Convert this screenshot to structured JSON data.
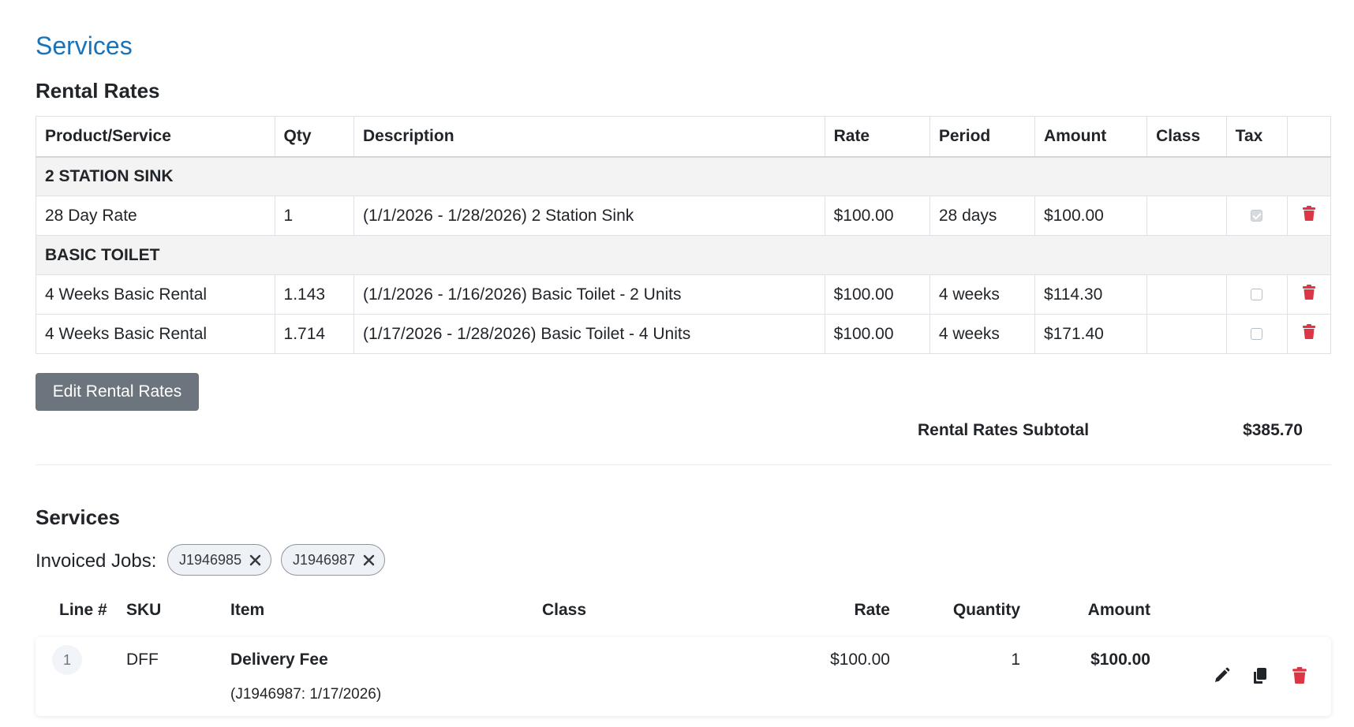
{
  "header": {
    "title": "Services"
  },
  "rental_rates": {
    "title": "Rental Rates",
    "columns": [
      "Product/Service",
      "Qty",
      "Description",
      "Rate",
      "Period",
      "Amount",
      "Class",
      "Tax"
    ],
    "groups": [
      {
        "name": "2 STATION SINK",
        "rows": [
          {
            "product": "28 Day Rate",
            "qty": "1",
            "description": "(1/1/2026 - 1/28/2026) 2 Station Sink",
            "rate": "$100.00",
            "period": "28 days",
            "amount": "$100.00",
            "class": "",
            "tax": true
          }
        ]
      },
      {
        "name": "BASIC TOILET",
        "rows": [
          {
            "product": "4 Weeks Basic Rental",
            "qty": "1.143",
            "description": "(1/1/2026 - 1/16/2026) Basic Toilet - 2 Units",
            "rate": "$100.00",
            "period": "4 weeks",
            "amount": "$114.30",
            "class": "",
            "tax": false
          },
          {
            "product": "4 Weeks Basic Rental",
            "qty": "1.714",
            "description": "(1/17/2026 - 1/28/2026) Basic Toilet - 4 Units",
            "rate": "$100.00",
            "period": "4 weeks",
            "amount": "$171.40",
            "class": "",
            "tax": false
          }
        ]
      }
    ],
    "edit_button": "Edit Rental Rates",
    "subtotal_label": "Rental Rates Subtotal",
    "subtotal_value": "$385.70"
  },
  "services": {
    "title": "Services",
    "invoiced_label": "Invoiced Jobs:",
    "jobs": [
      "J1946985",
      "J1946987"
    ],
    "columns": {
      "line": "Line #",
      "sku": "SKU",
      "item": "Item",
      "class": "Class",
      "rate": "Rate",
      "quantity": "Quantity",
      "amount": "Amount"
    },
    "lines": [
      {
        "line": "1",
        "sku": "DFF",
        "item": "Delivery Fee",
        "detail": "(J1946987: 1/17/2026)",
        "class": "",
        "rate": "$100.00",
        "quantity": "1",
        "amount": "$100.00"
      }
    ]
  },
  "colors": {
    "accent": "#1a73b8",
    "danger": "#dc3545",
    "secondary": "#6c757d"
  },
  "icons": [
    "trash-icon",
    "close-icon",
    "pencil-icon",
    "copy-icon"
  ]
}
